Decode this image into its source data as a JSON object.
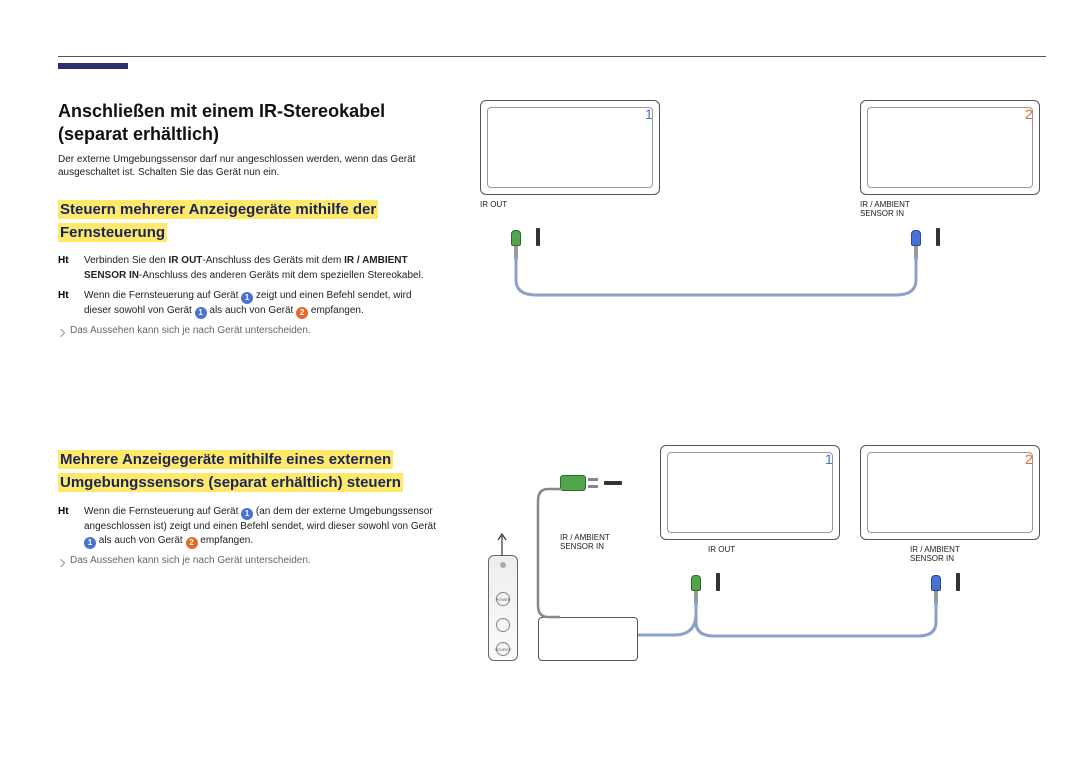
{
  "header": {
    "title_line1": "Anschließen mit einem IR-Stereokabel",
    "title_line2": "(separat erhältlich)",
    "intro": "Der externe Umgebungssensor darf nur angeschlossen werden, wenn das Gerät ausgeschaltet ist. Schalten Sie das Gerät nun ein."
  },
  "section1": {
    "heading": "Steuern mehrerer Anzeigegeräte mithilfe der Fernsteuerung",
    "li1a": "Verbinden Sie den ",
    "li1b": "IR OUT",
    "li1c": "-Anschluss des Geräts mit dem ",
    "li1d": "IR / AMBIENT SENSOR IN",
    "li1e": "-Anschluss des anderen Geräts mit dem speziellen Stereokabel.",
    "li2a": "Wenn die Fernsteuerung auf Gerät ",
    "li2b": " zeigt und einen Befehl sendet, wird dieser sowohl von Gerät ",
    "li2c": " als auch von Gerät ",
    "li2d": " empfangen.",
    "note": "Das Aussehen kann sich je nach Gerät unterscheiden."
  },
  "section2": {
    "heading": "Mehrere Anzeigegeräte mithilfe eines externen Umgebungssensors (separat erhältlich) steuern",
    "li1a": "Wenn die Fernsteuerung auf Gerät ",
    "li1b": " (an dem der externe Umgebungssensor angeschlossen ist) zeigt und einen Befehl sendet, wird dieser sowohl von Gerät ",
    "li1c": " als auch von Gerät ",
    "li1d": " empfangen.",
    "note": "Das Aussehen kann sich je nach Gerät unterscheiden."
  },
  "labels": {
    "num1": "1",
    "num2": "2",
    "ir_out": "IR OUT",
    "ir_amb": "IR / AMBIENT\nSENSOR IN",
    "power": "POWER",
    "source": "SOURCE"
  }
}
